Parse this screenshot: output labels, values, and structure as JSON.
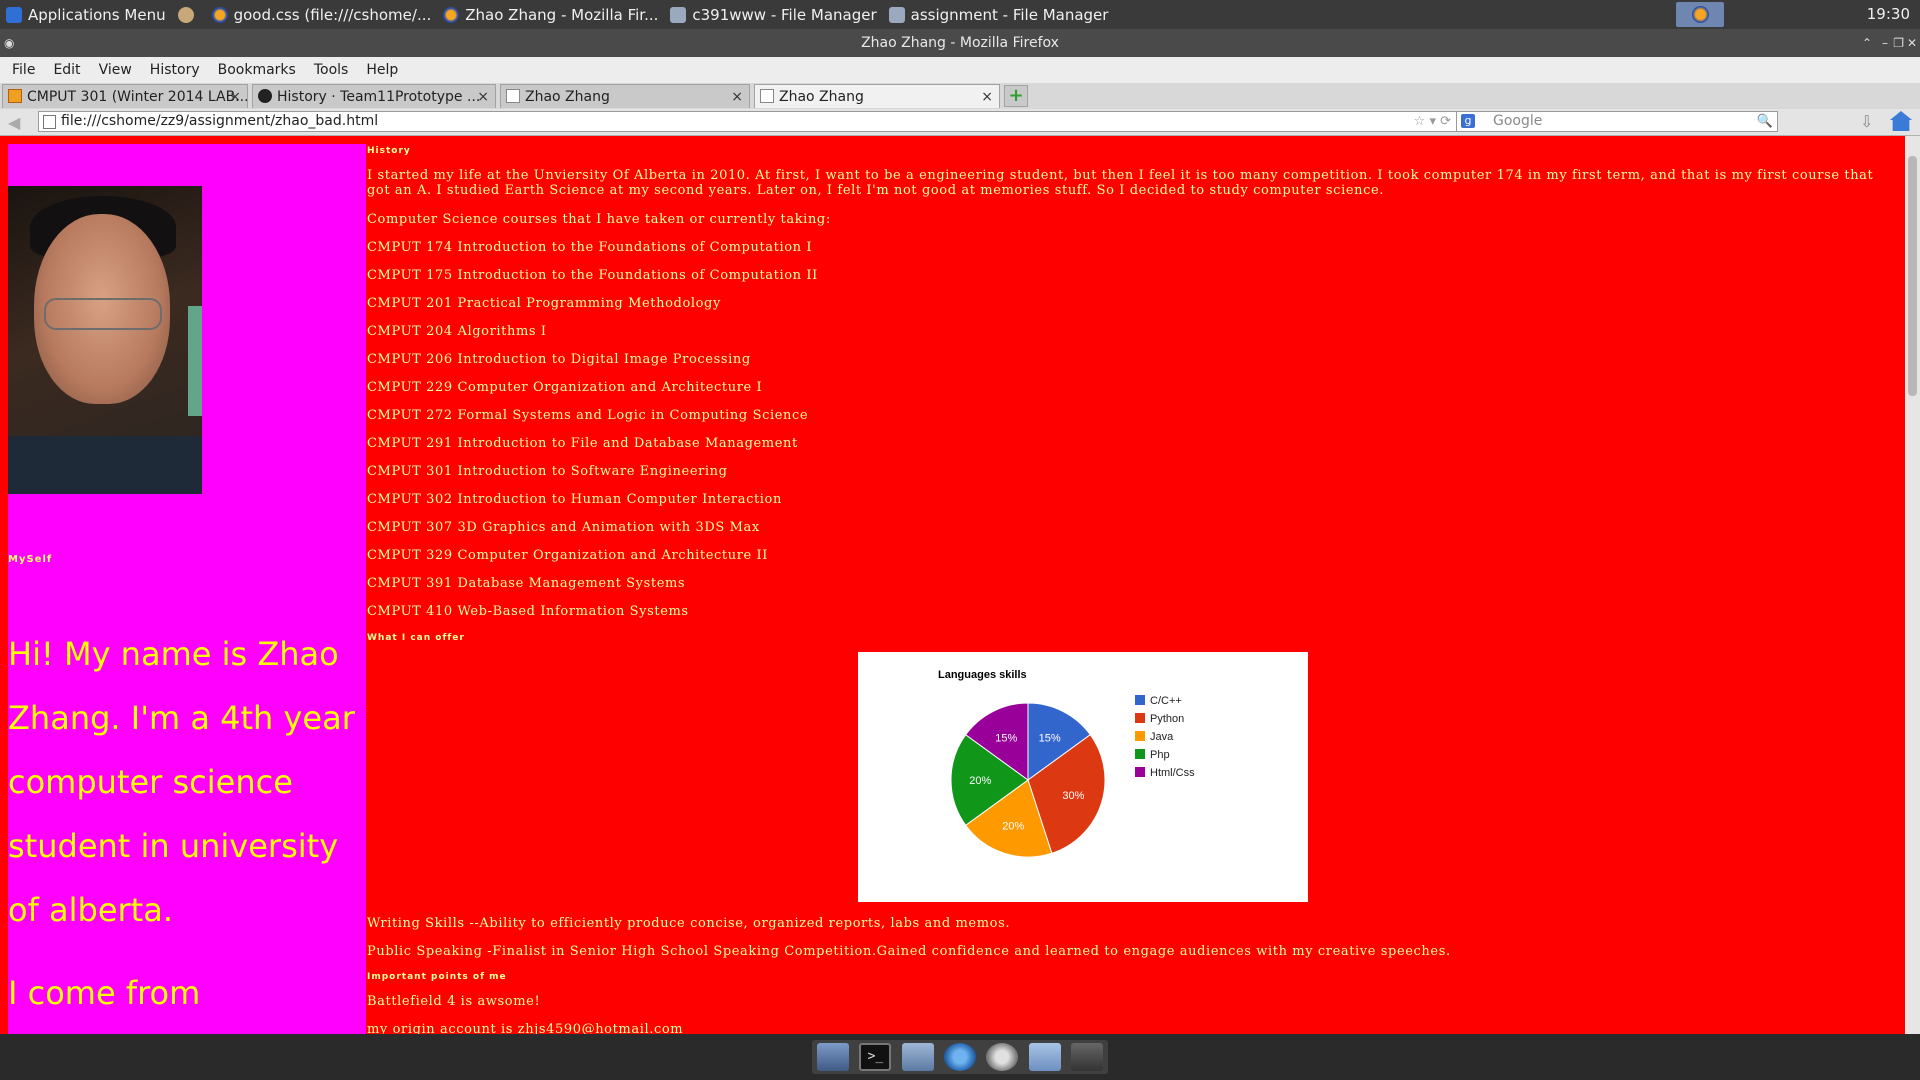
{
  "os_panel": {
    "tasks": [
      {
        "label": "Applications Menu",
        "icon": "apps-menu-icon"
      },
      {
        "label": "good.css (file:///cshome/...",
        "icon": "firefox-icon"
      },
      {
        "label": "Zhao Zhang - Mozilla Fir...",
        "icon": "firefox-icon"
      },
      {
        "label": "c391www - File Manager",
        "icon": "folder-icon"
      },
      {
        "label": "assignment - File Manager",
        "icon": "folder-icon"
      }
    ],
    "clock": "19:30"
  },
  "window": {
    "title": "Zhao Zhang - Mozilla Firefox"
  },
  "menubar": [
    "File",
    "Edit",
    "View",
    "History",
    "Bookmarks",
    "Tools",
    "Help"
  ],
  "tabs": [
    {
      "label": "CMPUT 301 (Winter 2014 LAB...",
      "icon": "course-icon",
      "close": "×"
    },
    {
      "label": "History · Team11Prototype ...",
      "icon": "github-icon",
      "close": "×"
    },
    {
      "label": "Zhao Zhang",
      "icon": "page-icon",
      "close": "×"
    },
    {
      "label": "Zhao Zhang",
      "icon": "page-icon",
      "close": "×",
      "active": true
    }
  ],
  "navbar": {
    "url": "file:///cshome/zz9/assignment/zhao_bad.html",
    "search_placeholder": "Google"
  },
  "sidebar": {
    "myself_heading": "MySelf",
    "intro": "Hi! My name is Zhao Zhang. I'm a 4th year computer science student in university of alberta.",
    "intro_2": "I come from"
  },
  "main": {
    "history_heading": "History",
    "history_text": "I started my life at the Unviersity Of Alberta in 2010. At first, I want to be a engineering student, but then I feel it is too many competition. I took computer 174 in my first term, and that is my first course that got an A. I studied Earth Science at my second years. Later on, I felt I'm not good at memories stuff. So I decided to study computer science.",
    "courses_intro": "Computer Science courses that I have taken or currently taking:",
    "courses": [
      "CMPUT 174 Introduction to the Foundations of Computation I",
      "CMPUT 175 Introduction to the Foundations of Computation II",
      "CMPUT 201 Practical Programming Methodology",
      "CMPUT 204 Algorithms I",
      "CMPUT 206 Introduction to Digital Image Processing",
      "CMPUT 229 Computer Organization and Architecture I",
      "CMPUT 272 Formal Systems and Logic in Computing Science",
      "CMPUT 291 Introduction to File and Database Management",
      "CMPUT 301 Introduction to Software Engineering",
      "CMPUT 302 Introduction to Human Computer Interaction",
      "CMPUT 307 3D Graphics and Animation with 3DS Max",
      "CMPUT 329 Computer Organization and Architecture II",
      "CMPUT 391 Database Management Systems",
      "CMPUT 410 Web-Based Information Systems"
    ],
    "offer_heading": "What I can offer",
    "writing": "Writing Skills --Ability to efficiently produce concise, organized reports, labs and memos.",
    "speaking": "Public Speaking -Finalist in Senior High School Speaking Competition.Gained confidence and learned to engage audiences with my creative speeches.",
    "important_heading": "Important points of me",
    "point_1": "Battlefield 4 is awsome!",
    "point_2": "my origin account is zhjs4590@hotmail.com"
  },
  "chart_data": {
    "type": "pie",
    "title": "Languages skills",
    "categories": [
      "C/C++",
      "Python",
      "Java",
      "Php",
      "Html/Css"
    ],
    "values": [
      15,
      30,
      20,
      20,
      15
    ],
    "labels": [
      "15%",
      "30%",
      "20%",
      "20%",
      "15%"
    ],
    "colors": [
      "#3366cc",
      "#dc3912",
      "#ff9900",
      "#109618",
      "#990099"
    ],
    "legend": "right"
  },
  "dock": [
    "desktop-icon",
    "terminal-icon",
    "file-manager-icon",
    "web-browser-icon",
    "search-icon",
    "folder-icon",
    "lock-icon"
  ],
  "colors": {
    "page_bg": "#ff0000",
    "sidebar_bg": "#ff00ff",
    "intro_text": "#ffff00",
    "body_text": "#ffff99"
  }
}
